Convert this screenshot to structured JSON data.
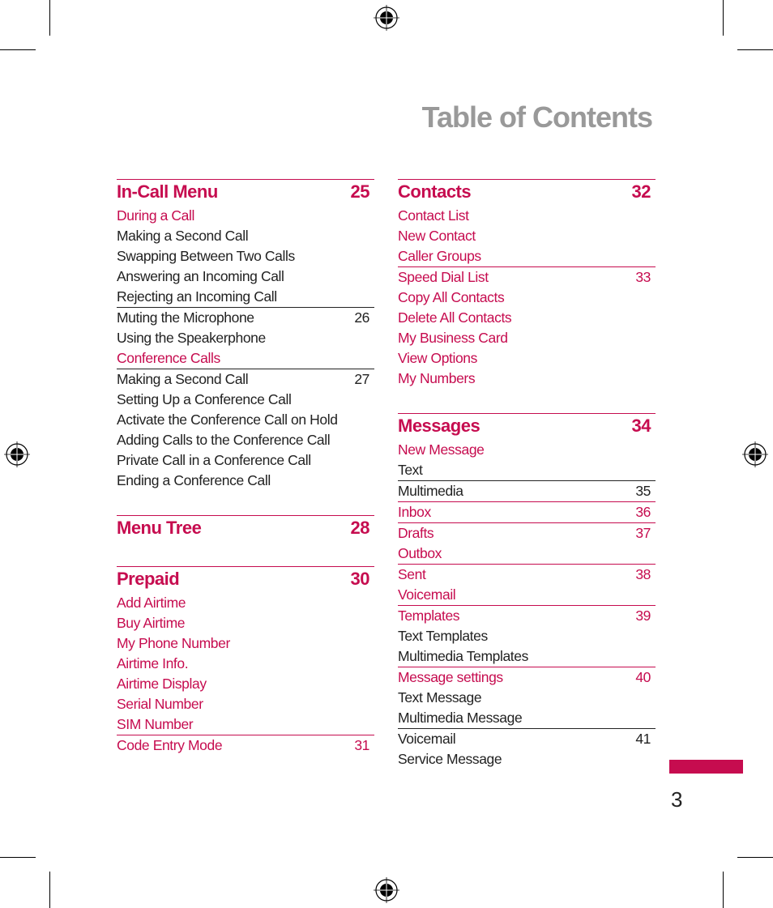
{
  "title": "Table of Contents",
  "page_number": "3",
  "accent_color": "#c60c4f",
  "left_column": [
    {
      "heading": "In-Call Menu",
      "page": "25",
      "items": [
        {
          "label": "During a Call",
          "style": "link",
          "page": "",
          "sep": "none"
        },
        {
          "label": "Making a Second Call",
          "style": "plain",
          "page": "",
          "sep": "none"
        },
        {
          "label": "Swapping Between Two Calls",
          "style": "plain",
          "page": "",
          "sep": "none"
        },
        {
          "label": "Answering an Incoming Call",
          "style": "plain",
          "page": "",
          "sep": "none"
        },
        {
          "label": "Rejecting an Incoming Call",
          "style": "plain",
          "page": "",
          "sep": "none"
        },
        {
          "label": "Muting the Microphone",
          "style": "plain",
          "page": "26",
          "sep": "dark"
        },
        {
          "label": "Using the Speakerphone",
          "style": "plain",
          "page": "",
          "sep": "none"
        },
        {
          "label": "Conference Calls",
          "style": "link",
          "page": "",
          "sep": "none"
        },
        {
          "label": "Making a Second Call",
          "style": "plain",
          "page": "27",
          "sep": "dark"
        },
        {
          "label": "Setting Up a Conference Call",
          "style": "plain",
          "page": "",
          "sep": "none"
        },
        {
          "label": "Activate the Conference Call on Hold",
          "style": "plain",
          "page": "",
          "sep": "none"
        },
        {
          "label": "Adding Calls to the Conference Call",
          "style": "plain",
          "page": "",
          "sep": "none"
        },
        {
          "label": "Private Call in a Conference Call",
          "style": "plain",
          "page": "",
          "sep": "none"
        },
        {
          "label": "Ending a Conference Call",
          "style": "plain",
          "page": "",
          "sep": "none"
        }
      ]
    },
    {
      "heading": "Menu Tree",
      "page": "28",
      "items": []
    },
    {
      "heading": "Prepaid",
      "page": "30",
      "items": [
        {
          "label": "Add Airtime",
          "style": "link",
          "page": "",
          "sep": "none"
        },
        {
          "label": "Buy Airtime",
          "style": "link",
          "page": "",
          "sep": "none"
        },
        {
          "label": "My Phone Number",
          "style": "link",
          "page": "",
          "sep": "none"
        },
        {
          "label": "Airtime Info.",
          "style": "link",
          "page": "",
          "sep": "none"
        },
        {
          "label": "Airtime Display",
          "style": "link",
          "page": "",
          "sep": "none"
        },
        {
          "label": "Serial Number",
          "style": "link",
          "page": "",
          "sep": "none"
        },
        {
          "label": "SIM Number",
          "style": "link",
          "page": "",
          "sep": "none"
        },
        {
          "label": "Code Entry Mode",
          "style": "link",
          "page": "31",
          "sep": "red"
        }
      ]
    }
  ],
  "right_column": [
    {
      "heading": "Contacts",
      "page": "32",
      "items": [
        {
          "label": "Contact List",
          "style": "link",
          "page": "",
          "sep": "none"
        },
        {
          "label": "New Contact",
          "style": "link",
          "page": "",
          "sep": "none"
        },
        {
          "label": "Caller Groups",
          "style": "link",
          "page": "",
          "sep": "none"
        },
        {
          "label": "Speed Dial List",
          "style": "link",
          "page": "33",
          "sep": "red"
        },
        {
          "label": "Copy All Contacts",
          "style": "link",
          "page": "",
          "sep": "none"
        },
        {
          "label": "Delete All Contacts",
          "style": "link",
          "page": "",
          "sep": "none"
        },
        {
          "label": "My Business Card",
          "style": "link",
          "page": "",
          "sep": "none"
        },
        {
          "label": "View Options",
          "style": "link",
          "page": "",
          "sep": "none"
        },
        {
          "label": "My Numbers",
          "style": "link",
          "page": "",
          "sep": "none"
        }
      ]
    },
    {
      "heading": "Messages",
      "page": "34",
      "items": [
        {
          "label": "New Message",
          "style": "link",
          "page": "",
          "sep": "none"
        },
        {
          "label": "Text",
          "style": "plain",
          "page": "",
          "sep": "none"
        },
        {
          "label": "Multimedia",
          "style": "plain",
          "page": "35",
          "sep": "dark"
        },
        {
          "label": "Inbox",
          "style": "link",
          "page": "36",
          "sep": "red"
        },
        {
          "label": "Drafts",
          "style": "link",
          "page": "37",
          "sep": "red"
        },
        {
          "label": "Outbox",
          "style": "link",
          "page": "",
          "sep": "none"
        },
        {
          "label": "Sent",
          "style": "link",
          "page": "38",
          "sep": "red"
        },
        {
          "label": "Voicemail",
          "style": "link",
          "page": "",
          "sep": "none"
        },
        {
          "label": "Templates",
          "style": "link",
          "page": "39",
          "sep": "red"
        },
        {
          "label": "Text Templates",
          "style": "plain",
          "page": "",
          "sep": "none"
        },
        {
          "label": "Multimedia Templates",
          "style": "plain",
          "page": "",
          "sep": "none"
        },
        {
          "label": "Message settings",
          "style": "link",
          "page": "40",
          "sep": "red"
        },
        {
          "label": "Text Message",
          "style": "plain",
          "page": "",
          "sep": "none"
        },
        {
          "label": "Multimedia Message",
          "style": "plain",
          "page": "",
          "sep": "none"
        },
        {
          "label": "Voicemail",
          "style": "plain",
          "page": "41",
          "sep": "dark"
        },
        {
          "label": "Service Message",
          "style": "plain",
          "page": "",
          "sep": "none"
        }
      ]
    }
  ]
}
